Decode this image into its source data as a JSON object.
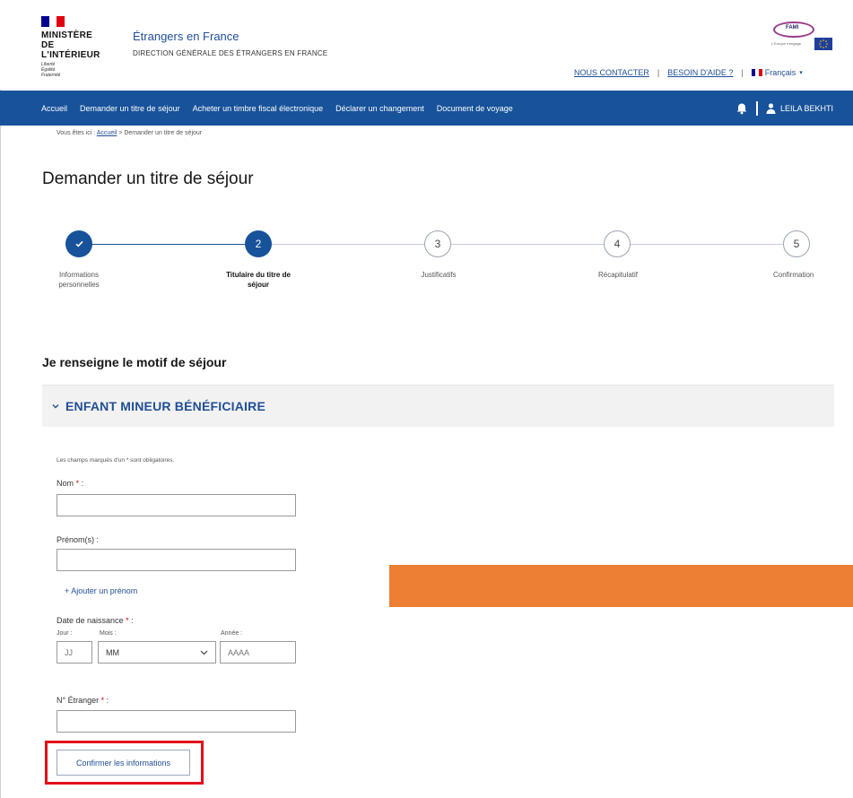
{
  "header": {
    "logo_lines": [
      "MINISTÈRE",
      "DE L'INTÉRIEUR"
    ],
    "motto": [
      "Liberté",
      "Égalité",
      "Fraternité"
    ],
    "site_title": "Étrangers en France",
    "site_subtitle": "DIRECTION GÉNÉRALE DES ÉTRANGERS EN FRANCE",
    "eu_badge_text": "FAMI",
    "eu_caption": "L'Europe s'engage",
    "links": {
      "contact": "NOUS CONTACTER",
      "help": "BESOIN D'AIDE ?",
      "language": "Français",
      "sep1": "|",
      "sep2": "|"
    }
  },
  "nav": {
    "items": [
      "Accueil",
      "Demander un titre de séjour",
      "Acheter un timbre fiscal électronique",
      "Déclarer un changement",
      "Document de voyage"
    ],
    "user_name": "LEILA BEKHTI"
  },
  "breadcrumb": {
    "prefix": "Vous êtes ici :",
    "home": "Accueil",
    "separator": ">",
    "current": "Demander un titre de séjour"
  },
  "page_title": "Demander un titre de séjour",
  "stepper": {
    "steps": [
      {
        "number": "1",
        "label_line1": "Informations",
        "label_line2": "personnelles",
        "state": "done"
      },
      {
        "number": "2",
        "label_line1": "Titulaire du titre de",
        "label_line2": "séjour",
        "state": "current"
      },
      {
        "number": "3",
        "label_line1": "Justificatifs",
        "label_line2": "",
        "state": "todo"
      },
      {
        "number": "4",
        "label_line1": "Récapitulatif",
        "label_line2": "",
        "state": "todo"
      },
      {
        "number": "5",
        "label_line1": "Confirmation",
        "label_line2": "",
        "state": "todo"
      }
    ]
  },
  "section_title": "Je renseigne le motif de séjour",
  "accordion_title": "ENFANT MINEUR BÉNÉFICIAIRE",
  "form": {
    "required_note": "Les champs marqués d'un * sont obligatoires.",
    "required_mark": "*",
    "nom_label": "Nom",
    "prenom_label": "Prénom(s) :",
    "add_prenom": "+ Ajouter un prénom",
    "birth_label": "Date de naissance",
    "jour_label": "Jour :",
    "mois_label": "Mois :",
    "annee_label": "Année :",
    "jour_placeholder": "JJ",
    "mois_value": "MM",
    "annee_placeholder": "AAAA",
    "etranger_label": "N° Étranger",
    "colon": ":",
    "confirm_button": "Confirmer les informations"
  },
  "colors": {
    "primary": "#17529a",
    "link": "#1f4e96",
    "accent_orange": "#ec7f33",
    "highlight_red": "#e20f1a",
    "flag_blue": "#000091",
    "flag_red": "#e1000f"
  }
}
